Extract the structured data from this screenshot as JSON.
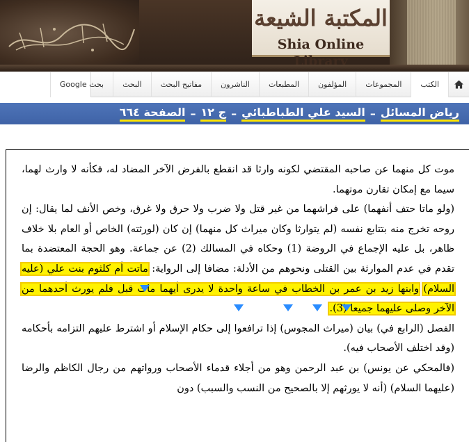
{
  "header": {
    "logo_arabic": "المكتبة الشيعة",
    "logo_english": "Shia Online Library",
    "calligraphy_icon": "bismillah-calligraphy-icon"
  },
  "nav": {
    "home_icon": "home-icon",
    "items": [
      {
        "label": "الكتب"
      },
      {
        "label": "المجموعات"
      },
      {
        "label": "المؤلفون"
      },
      {
        "label": "المطبعات"
      },
      {
        "label": "الناشرون"
      },
      {
        "label": "مفاتيح البحث"
      },
      {
        "label": "البحث"
      },
      {
        "label": "بحث Google"
      }
    ]
  },
  "title": {
    "book": "رياض المسائل",
    "author": "السيد علي الطباطبائي",
    "volume": "ج ١٢",
    "page": "الصفحة ٦٦٤",
    "separator": "–"
  },
  "body": {
    "p1": "موت كل منهما عن صاحبه المقتضي لكونه وارثا قد انقطع بالفرض الآخر المضاد له، فكأنه لا وارث لهما، سيما مع إمكان تقارن موتهما.",
    "p2": "(ولو ماتا حتف أنفهما) على فراشهما من غير قتل ولا ضرب ولا حرق ولا غرق، وخص الأنف لما يقال: إن روحه تخرج منه بتتابع نفسه (لم يتوارثا وكان ميراث كل منهما) إن كان (لورثته) الخاص أو العام بلا خلاف ظاهر، بل عليه الإجماع في الروضة (1) وحكاه في المسالك (2) عن جماعة. وهو الحجة المعتضدة بما تقدم في عدم الموارثة بين القتلى ونحوهم من الأدلة: مضافا إلى الرواية:",
    "p2_hl_a": "ماتت أم كلثوم بنت علي (عليه السلام)",
    "p2_hl_b": "وابنها زيد بن عمر بن الخطاب في ساعة واحدة لا يدرى أيهما مات قبل فلم يورث أحدهما من الآخر وصلى عليهما جميعا (3).",
    "p3": "الفصل (الرابع في) بيان (ميراث المجوس) إذا ترافعوا إلى حكام الإسلام أو اشترط عليهم التزامه بأحكامه (وقد اختلف الأصحاب فيه).",
    "p4": "(فالمحكي عن يونس) بن عبد الرحمن وهو من أجلاء قدماء الأصحاب ورواتهم من رجال الكاظم والرضا (عليهما السلام) (أنه لا يورثهم إلا بالصحيح من النسب والسبب) دون"
  },
  "colors": {
    "title_bar": "#4a6db3",
    "highlight": "#fff200",
    "title_underline": "#ffe500",
    "annotation_red": "#e00000",
    "annotation_blue": "#1a3cff"
  }
}
